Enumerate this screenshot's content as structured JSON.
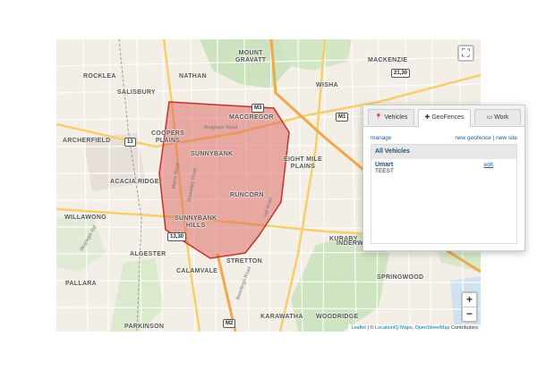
{
  "map": {
    "place_labels": {
      "mount_gravatt": "MOUNT\nGRAVATT",
      "mackenzie": "MACKENZIE",
      "rocklea": "ROCKLEA",
      "salisbury": "SALISBURY",
      "nathan": "NATHAN",
      "wisha": "WISHA",
      "macgregor": "MACGREGOR",
      "coopers_plains": "COOPERS\nPLAINS",
      "archerfield": "ARCHERFIELD",
      "sunnybank": "SUNNYBANK",
      "eight_mile_plains": "EIGHT MILE\nPLAINS",
      "acacia_ridge": "ACACIA RIDGE",
      "runcorn": "RUNCORN",
      "willawong": "WILLAWONG",
      "sunnybank_hills": "SUNNYBANK\nHILLS",
      "kuraby": "KURABY",
      "underwood": "INDERWO",
      "algester": "ALGESTER",
      "stretton": "STRETTON",
      "calamvale": "CALAMVALE",
      "pallara": "PALLARA",
      "springwood": "SPRINGWOOD",
      "karawatha": "KARAWATHA",
      "woodridge": "WOODRIDGE",
      "parkinson": "PARKINSON"
    },
    "road_labels": {
      "mcgregor_rd": "Mcgregor Rd",
      "mains_rd": "Mains Road",
      "beenleigh_rd": "Beenleigh Road",
      "mulgrave_rd": "Mulgrave Road",
      "hill_rd": "Hill Road",
      "boundary_rd": "Boundary Road"
    },
    "shields": {
      "m3": "M3",
      "r13": "13",
      "m1": "M1",
      "r2130": "21,30",
      "r2130b": "13,30",
      "m2": "M2"
    },
    "geofence_color": "#d9534f",
    "zoom_in": "+",
    "zoom_out": "−",
    "fullscreen_icon": "⛶",
    "attribution": {
      "leaflet": "Leaflet",
      "sep": " | © ",
      "locationiq": "LocationIQ Maps",
      "comma": ", ",
      "osm": "OpenStreetMap",
      "contributors": " Contributors"
    }
  },
  "panel": {
    "tabs": [
      {
        "icon": "📍",
        "label": "Vehicles"
      },
      {
        "icon": "✚",
        "label": "GeoFences"
      },
      {
        "icon": "▭",
        "label": "Work"
      }
    ],
    "manage": "manage",
    "new_geofence": "new geofence",
    "separator": "|",
    "new_site": "new site",
    "list_header": "All Vehicles",
    "items": [
      {
        "name": "Umart",
        "sub": "TEEST",
        "edit": "edit"
      }
    ]
  }
}
